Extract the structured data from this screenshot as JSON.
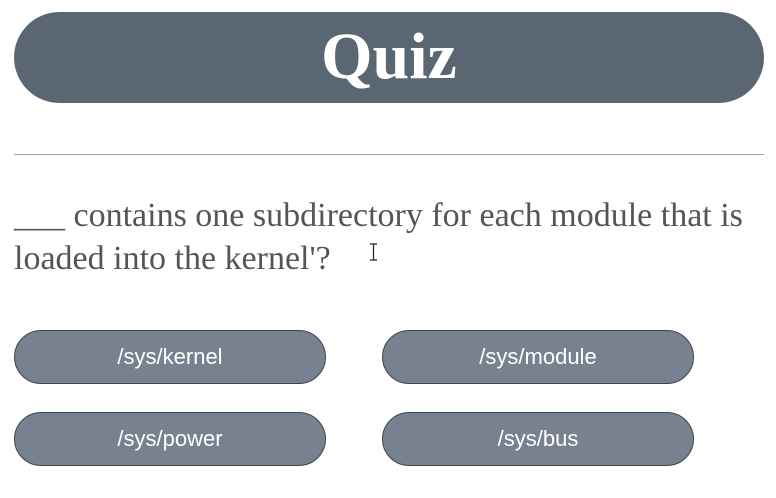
{
  "header": {
    "title": "Quiz"
  },
  "question": {
    "text": "___ contains one subdirectory for each module that is loaded into the kernel'?"
  },
  "answers": [
    {
      "label": "/sys/kernel"
    },
    {
      "label": "/sys/module"
    },
    {
      "label": "/sys/power"
    },
    {
      "label": "/sys/bus"
    }
  ],
  "colors": {
    "header_bg": "#5a6672",
    "button_bg": "#77818f",
    "button_border": "#3e4650",
    "question_text": "#555555"
  }
}
